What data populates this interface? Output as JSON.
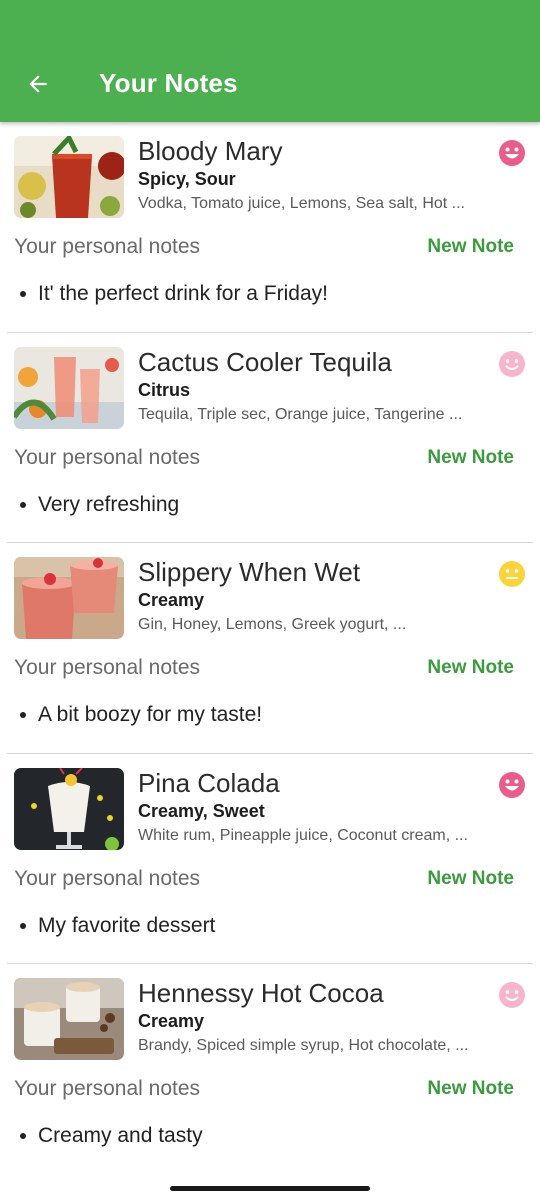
{
  "appbar": {
    "title": "Your Notes",
    "back_icon": "arrow-back-icon",
    "color": "#4caf50"
  },
  "labels": {
    "personal_notes": "Your personal notes",
    "new_note": "New Note"
  },
  "notes": [
    {
      "name": "Bloody Mary",
      "flavor": "Spicy, Sour",
      "ingredients": "Vodka, Tomato juice, Lemons, Sea salt, Hot ...",
      "mood_icon": "grinning-face-icon",
      "mood_color": "#e85d8c",
      "note": "It' the perfect drink for a Friday!"
    },
    {
      "name": "Cactus Cooler Tequila",
      "flavor": "Citrus",
      "ingredients": "Tequila, Triple sec, Orange juice, Tangerine ...",
      "mood_icon": "smiling-face-icon",
      "mood_color": "#f7b5cb",
      "note": "Very refreshing"
    },
    {
      "name": "Slippery When Wet",
      "flavor": "Creamy",
      "ingredients": "Gin, Honey, Lemons, Greek yogurt, ...",
      "mood_icon": "neutral-face-icon",
      "mood_color": "#fbd33b",
      "note": "A bit boozy for my taste!"
    },
    {
      "name": "Pina Colada",
      "flavor": "Creamy, Sweet",
      "ingredients": "White rum, Pineapple juice, Coconut cream, ...",
      "mood_icon": "grinning-face-icon",
      "mood_color": "#e85d8c",
      "note": "My favorite dessert"
    },
    {
      "name": "Hennessy Hot Cocoa",
      "flavor": "Creamy",
      "ingredients": "Brandy, Spiced simple syrup, Hot chocolate, ...",
      "mood_icon": "smiling-face-icon",
      "mood_color": "#f7b5cb",
      "note": "Creamy and tasty"
    }
  ]
}
